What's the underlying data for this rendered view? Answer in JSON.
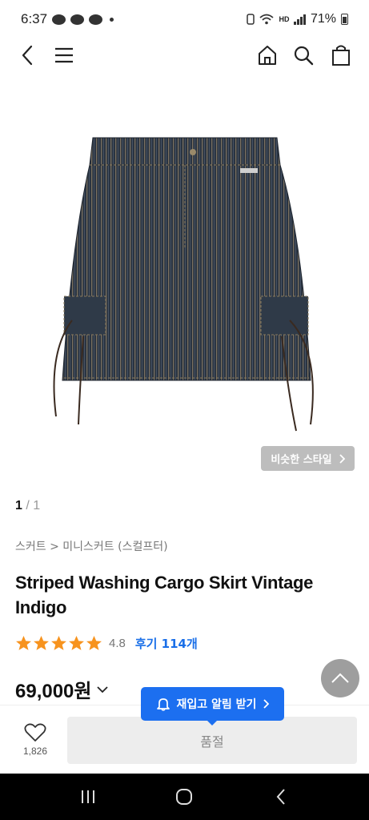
{
  "status_bar": {
    "time": "6:37",
    "battery": "71%",
    "network": "HD"
  },
  "product": {
    "image_counter": {
      "current": "1",
      "total": "/ 1"
    },
    "similar_style_label": "비슷한 스타일",
    "breadcrumb": "스커트 > 미니스커트 (스컬프터)",
    "title": "Striped Washing Cargo Skirt Vintage Indigo",
    "rating": {
      "stars": 5,
      "score": "4.8",
      "review_label": "후기 114개"
    },
    "price": "69,000원"
  },
  "restock_tooltip": {
    "label": "재입고 알림 받기"
  },
  "bottom_bar": {
    "like_count": "1,826",
    "soldout_label": "품절"
  },
  "colors": {
    "accent": "#1c6ff0",
    "star": "#f7931e",
    "soldout_bg": "#ededed"
  },
  "icons": [
    "back-icon",
    "menu-icon",
    "home-icon",
    "search-icon",
    "bag-icon",
    "heart-icon",
    "bell-icon",
    "chevron-up-icon",
    "recent-apps-icon",
    "home-circle-icon",
    "back-arrow-icon"
  ]
}
